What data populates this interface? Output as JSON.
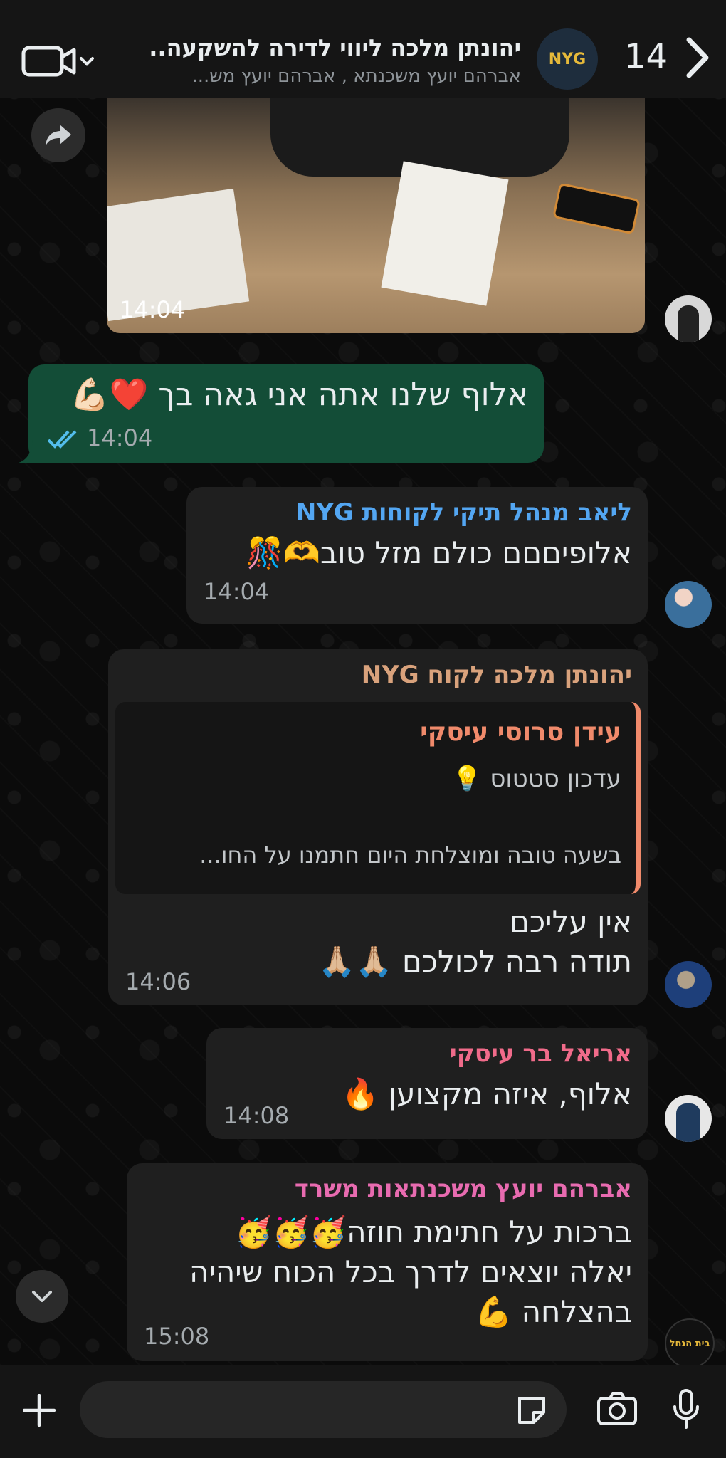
{
  "header": {
    "unread_count": "14",
    "group_title": "יהונתן מלכה ליווי לדירה להשקעה...",
    "group_subtitle": "אברהם יועץ משכנתא , אברהם יועץ מש...",
    "avatar_logo": "NYG"
  },
  "messages": [
    {
      "type": "image",
      "time": "14:04"
    },
    {
      "type": "outgoing",
      "text": "אלוף שלנו אתה אני גאה בך ❤️💪🏻",
      "time": "14:04"
    },
    {
      "type": "incoming",
      "sender": "ליאב מנהל תיקי לקוחות NYG",
      "sender_color": "#53a6f2",
      "text": "אלופיםםם כולם מזל טוב🫶🎊",
      "time": "14:04"
    },
    {
      "type": "reply",
      "sender": "יהונתן מלכה לקוח NYG",
      "sender_color": "#d9a27c",
      "quote": {
        "author": "עידן סרוסי עיסקי",
        "author_color": "#f08a6b",
        "line1": "עדכון סטטוס 💡",
        "line2": "בשעה טובה ומוצלחת היום חתמנו על החו..."
      },
      "lines": [
        "אין עליכם",
        "תודה רבה לכולכם 🙏🏼🙏🏼"
      ],
      "time": "14:06"
    },
    {
      "type": "incoming",
      "sender": "אריאל בר עיסקי",
      "sender_color": "#f06b8a",
      "text": "אלוף, איזה מקצוען 🔥",
      "time": "14:08"
    },
    {
      "type": "incoming",
      "sender": "אברהם יועץ משכנתאות משרד",
      "sender_color": "#e86bb0",
      "lines": [
        "ברכות על חתימת חוזה🥳🥳🥳",
        "יאלה יוצאים לדרך בכל הכוח שיהיה",
        "בהצלחה 💪"
      ],
      "time": "15:08",
      "avatar_text": "בית הנחל"
    }
  ],
  "colors": {
    "outgoing_bubble": "#134d37",
    "incoming_bubble": "#1f1f1f",
    "read_ticks": "#53bdeb"
  },
  "icons": [
    "back-chevron-icon",
    "video-call-icon",
    "forward-icon",
    "scroll-down-icon",
    "plus-icon",
    "sticker-icon",
    "camera-icon",
    "microphone-icon",
    "read-ticks-icon"
  ]
}
